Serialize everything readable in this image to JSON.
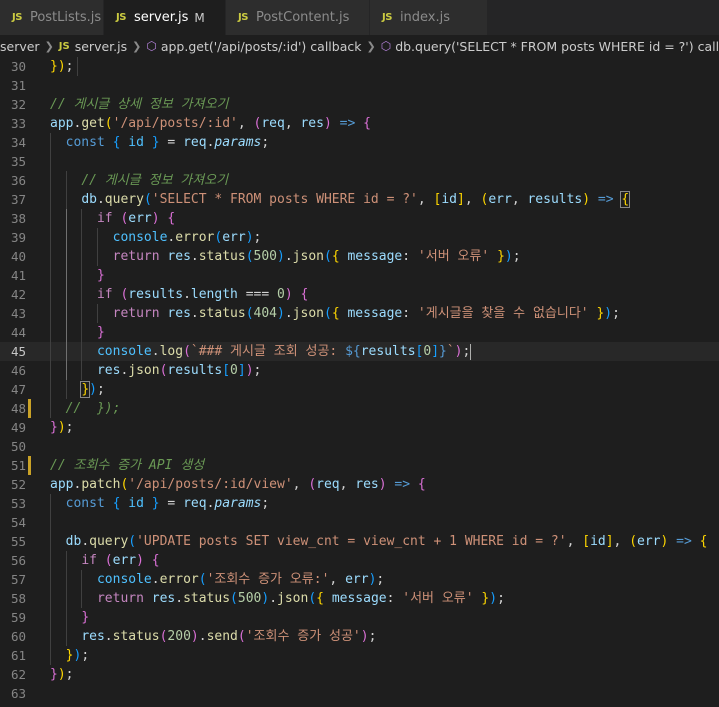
{
  "tabs": [
    {
      "label": "PostLists.js",
      "active": false,
      "modified": ""
    },
    {
      "label": "server.js",
      "active": true,
      "modified": "M"
    },
    {
      "label": "PostContent.js",
      "active": false,
      "modified": ""
    },
    {
      "label": "index.js",
      "active": false,
      "modified": ""
    }
  ],
  "tab_icon": "JS",
  "breadcrumb": {
    "folder": "server",
    "file_icon": "JS",
    "file": "server.js",
    "symbol1": "app.get('/api/posts/:id') callback",
    "symbol2": "db.query('SELECT * FROM posts WHERE id = ?') callback"
  },
  "current_line": 45,
  "changed_lines": [
    48,
    51
  ],
  "lines": [
    {
      "n": 30,
      "code": "<span class='br1'>}</span><span class='br1'>)</span>;",
      "guides": [
        28
      ]
    },
    {
      "n": 31,
      "code": "",
      "guides": []
    },
    {
      "n": 32,
      "code": "<span class='com'>// 게시글 상세 정보 가져오기</span>",
      "guides": []
    },
    {
      "n": 33,
      "code": "<span class='var'>app</span>.<span class='fn'>get</span><span class='br1'>(</span><span class='str'>'/api/posts/:id'</span>, <span class='br2'>(</span><span class='var'>req</span>, <span class='var'>res</span><span class='br2'>)</span> <span class='kw'>=&gt;</span> <span class='br2'>{</span>",
      "guides": []
    },
    {
      "n": 34,
      "code": "  <span class='kw'>const</span> <span class='br3'>{</span> <span class='obj'>id</span> <span class='br3'>}</span> = <span class='var'>req</span>.<span class='var it'>params</span>;",
      "guides": [
        0
      ]
    },
    {
      "n": 35,
      "code": "",
      "guides": [
        0
      ]
    },
    {
      "n": 36,
      "code": "    <span class='com'>// 게시글 정보 가져오기</span>",
      "guides": [
        0,
        16
      ]
    },
    {
      "n": 37,
      "code": "    <span class='var'>db</span>.<span class='fn'>query</span><span class='br3'>(</span><span class='str'>'SELECT * FROM posts WHERE id = ?'</span>, <span class='br1'>[</span><span class='var'>id</span><span class='br1'>]</span>, <span class='br1'>(</span><span class='var'>err</span>, <span class='var'>results</span><span class='br1'>)</span> <span class='kw'>=&gt;</span> <span class='br1 bracket-box'>{</span>",
      "guides": [
        0,
        16
      ]
    },
    {
      "n": 38,
      "code": "      <span class='ctl'>if</span> <span class='br2'>(</span><span class='var'>err</span><span class='br2'>)</span> <span class='br2'>{</span>",
      "guides": [
        0,
        16,
        32
      ]
    },
    {
      "n": 39,
      "code": "        <span class='obj'>console</span>.<span class='fn'>error</span><span class='br3'>(</span><span class='var'>err</span><span class='br3'>)</span>;",
      "guides": [
        0,
        16,
        32,
        48
      ]
    },
    {
      "n": 40,
      "code": "        <span class='ctl'>return</span> <span class='var'>res</span>.<span class='fn'>status</span><span class='br3'>(</span><span class='num'>500</span><span class='br3'>)</span>.<span class='fn'>json</span><span class='br3'>(</span><span class='br1'>{</span> <span class='var'>message</span>: <span class='str'>'서버 오류'</span> <span class='br1'>}</span><span class='br3'>)</span>;",
      "guides": [
        0,
        16,
        32,
        48
      ]
    },
    {
      "n": 41,
      "code": "      <span class='br2'>}</span>",
      "guides": [
        0,
        16,
        32
      ]
    },
    {
      "n": 42,
      "code": "      <span class='ctl'>if</span> <span class='br2'>(</span><span class='var'>results</span>.<span class='var'>length</span> === <span class='num'>0</span><span class='br2'>)</span> <span class='br2'>{</span>",
      "guides": [
        0,
        16,
        32
      ]
    },
    {
      "n": 43,
      "code": "        <span class='ctl'>return</span> <span class='var'>res</span>.<span class='fn'>status</span><span class='br3'>(</span><span class='num'>404</span><span class='br3'>)</span>.<span class='fn'>json</span><span class='br3'>(</span><span class='br1'>{</span> <span class='var'>message</span>: <span class='str'>'게시글을 찾을 수 없습니다'</span> <span class='br1'>}</span><span class='br3'>)</span>;",
      "guides": [
        0,
        16,
        32,
        48
      ]
    },
    {
      "n": 44,
      "code": "      <span class='br2'>}</span>",
      "guides": [
        0,
        16,
        32
      ]
    },
    {
      "n": 45,
      "code": "      <span class='obj'>console</span>.<span class='fn'>log</span><span class='br2'>(</span><span class='str'>`### 게시글 조회 성공: </span><span class='tpl'>${</span><span class='var'>results</span><span class='br3'>[</span><span class='num'>0</span><span class='br3'>]</span><span class='tpl'>}</span><span class='str'>`</span><span class='br2'>)</span>;<span class='cursor'></span>",
      "guides": [
        0,
        16,
        32
      ]
    },
    {
      "n": 46,
      "code": "      <span class='var'>res</span>.<span class='fn'>json</span><span class='br2'>(</span><span class='var'>results</span><span class='br3'>[</span><span class='num'>0</span><span class='br3'>]</span><span class='br2'>)</span>;",
      "guides": [
        0,
        16,
        32
      ]
    },
    {
      "n": 47,
      "code": "    <span class='br1 bracket-box'>}</span><span class='br3'>)</span>;",
      "guides": [
        0,
        16
      ]
    },
    {
      "n": 48,
      "code": "  <span class='com'>//  });</span>",
      "guides": [
        0
      ]
    },
    {
      "n": 49,
      "code": "<span class='br2'>}</span><span class='br1'>)</span>;",
      "guides": []
    },
    {
      "n": 50,
      "code": "",
      "guides": []
    },
    {
      "n": 51,
      "code": "<span class='com'>// 조회수 증가 API 생성</span>",
      "guides": []
    },
    {
      "n": 52,
      "code": "<span class='var'>app</span>.<span class='fn'>patch</span><span class='br1'>(</span><span class='str'>'/api/posts/:id/view'</span>, <span class='br2'>(</span><span class='var'>req</span>, <span class='var'>res</span><span class='br2'>)</span> <span class='kw'>=&gt;</span> <span class='br2'>{</span>",
      "guides": []
    },
    {
      "n": 53,
      "code": "  <span class='kw'>const</span> <span class='br3'>{</span> <span class='obj'>id</span> <span class='br3'>}</span> = <span class='var'>req</span>.<span class='var it'>params</span>;",
      "guides": [
        0
      ]
    },
    {
      "n": 54,
      "code": "",
      "guides": [
        0
      ]
    },
    {
      "n": 55,
      "code": "  <span class='var'>db</span>.<span class='fn'>query</span><span class='br3'>(</span><span class='str'>'UPDATE posts SET view_cnt = view_cnt + 1 WHERE id = ?'</span>, <span class='br1'>[</span><span class='var'>id</span><span class='br1'>]</span>, <span class='br1'>(</span><span class='var'>err</span><span class='br1'>)</span> <span class='kw'>=&gt;</span> <span class='br1'>{</span>",
      "guides": [
        0
      ]
    },
    {
      "n": 56,
      "code": "    <span class='ctl'>if</span> <span class='br2'>(</span><span class='var'>err</span><span class='br2'>)</span> <span class='br2'>{</span>",
      "guides": [
        0,
        16
      ]
    },
    {
      "n": 57,
      "code": "      <span class='obj'>console</span>.<span class='fn'>error</span><span class='br3'>(</span><span class='str'>'조회수 증가 오류:'</span>, <span class='var'>err</span><span class='br3'>)</span>;",
      "guides": [
        0,
        16,
        32
      ]
    },
    {
      "n": 58,
      "code": "      <span class='ctl'>return</span> <span class='var'>res</span>.<span class='fn'>status</span><span class='br3'>(</span><span class='num'>500</span><span class='br3'>)</span>.<span class='fn'>json</span><span class='br3'>(</span><span class='br1'>{</span> <span class='var'>message</span>: <span class='str'>'서버 오류'</span> <span class='br1'>}</span><span class='br3'>)</span>;",
      "guides": [
        0,
        16,
        32
      ]
    },
    {
      "n": 59,
      "code": "    <span class='br2'>}</span>",
      "guides": [
        0,
        16
      ]
    },
    {
      "n": 60,
      "code": "    <span class='var'>res</span>.<span class='fn'>status</span><span class='br2'>(</span><span class='num'>200</span><span class='br2'>)</span>.<span class='fn'>send</span><span class='br2'>(</span><span class='str'>'조회수 증가 성공'</span><span class='br2'>)</span>;",
      "guides": [
        0,
        16
      ]
    },
    {
      "n": 61,
      "code": "  <span class='br1'>}</span><span class='br3'>)</span>;",
      "guides": [
        0
      ]
    },
    {
      "n": 62,
      "code": "<span class='br2'>}</span><span class='br1'>)</span>;",
      "guides": []
    },
    {
      "n": 63,
      "code": "",
      "guides": []
    }
  ]
}
